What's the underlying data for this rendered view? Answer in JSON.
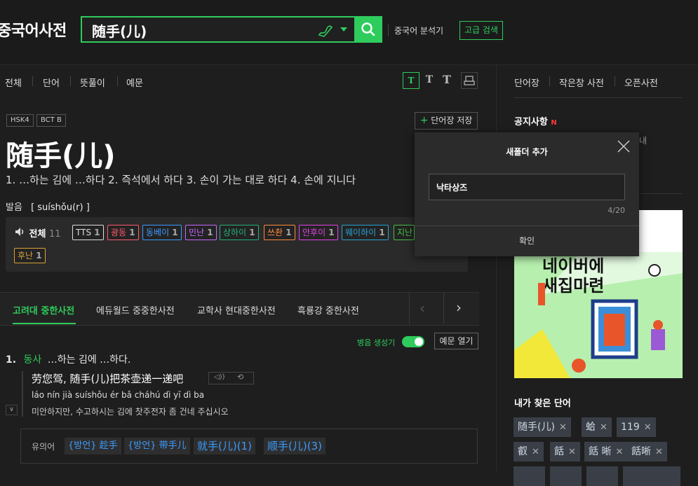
{
  "header": {
    "logo": "중국어사전",
    "search_value": "随手(儿)",
    "analyzer_label": "중국어 분석기",
    "advanced_label": "고급 검색"
  },
  "nav_tabs": [
    "전체",
    "단어",
    "뜻풀이",
    "예문"
  ],
  "font_buttons": [
    "T",
    "T",
    "T"
  ],
  "entry": {
    "badges": [
      "HSK4",
      "BCT B"
    ],
    "save_label": "단어장 저장",
    "headword": "随手(儿)",
    "meaning": "1. …하는 김에 …하다 2. 즉석에서 하다 3. 손이 가는 대로 하다 4. 손에 지니다",
    "pron_label": "발음",
    "pron_value": "[ suíshǒu(r) ]"
  },
  "dialects": {
    "all_label": "전체",
    "all_count": "11",
    "items": [
      {
        "label": "TTS",
        "count": "1",
        "color": "#dddddd"
      },
      {
        "label": "광동",
        "count": "1",
        "color": "#ff5a6e"
      },
      {
        "label": "동베이",
        "count": "1",
        "color": "#3c9cff"
      },
      {
        "label": "민난",
        "count": "1",
        "color": "#c868ff"
      },
      {
        "label": "상하이",
        "count": "1",
        "color": "#26b07a"
      },
      {
        "label": "쓰촨",
        "count": "1",
        "color": "#ff8a3d"
      },
      {
        "label": "안후이",
        "count": "1",
        "color": "#e044e6"
      },
      {
        "label": "웨이하이",
        "count": "1",
        "color": "#29a3d6"
      },
      {
        "label": "지난",
        "count": "",
        "color": "#47c247"
      },
      {
        "label": "후난",
        "count": "1",
        "color": "#d9a23a"
      }
    ]
  },
  "dict_tabs": [
    "고려대 중한사전",
    "에듀월드 중중한사전",
    "교학사 현대중한사전",
    "흑룡강 중한사전"
  ],
  "pinyin_toggle_label": "병음 생성기",
  "example_open_label": "예문 열기",
  "sense": {
    "num": "1.",
    "pos": "동사",
    "def": "…하는 김에 …하다.",
    "example_zh": "劳您驾, 随手(儿)把茶壶递一递吧",
    "example_pinyin": "láo nín jià suíshǒu ér bǎ cháhú dì yī dì ba",
    "example_ko": "미안하지만, 수고하시는 김에 찻주전자 좀 건네 주십시오"
  },
  "synonyms": {
    "label": "유의어",
    "items": [
      "{방언} 趁手",
      "{방언} 带手儿",
      "就手(儿)(1)",
      "顺手(儿)(3)"
    ]
  },
  "right_tabs": [
    "단어장",
    "작은창 사전",
    "오픈사전"
  ],
  "notice": {
    "label": "공지사항",
    "new_badge": "N",
    "partial_text": "내"
  },
  "popup": {
    "title": "새폴더 추가",
    "input_value": "낙타상즈",
    "counter": "4/20",
    "confirm_label": "확인"
  },
  "ad": {
    "line1": "네이버에",
    "line2": "새집마련"
  },
  "recent": {
    "title": "내가 찾은 단어",
    "items": [
      "随手(儿)",
      "蛤",
      "119",
      "叡",
      "餂",
      "餂 晰",
      "餂晰"
    ]
  },
  "colors": {
    "accent": "#2ecc5c",
    "link": "#3c9cff",
    "pos": "#2ecc5c"
  }
}
